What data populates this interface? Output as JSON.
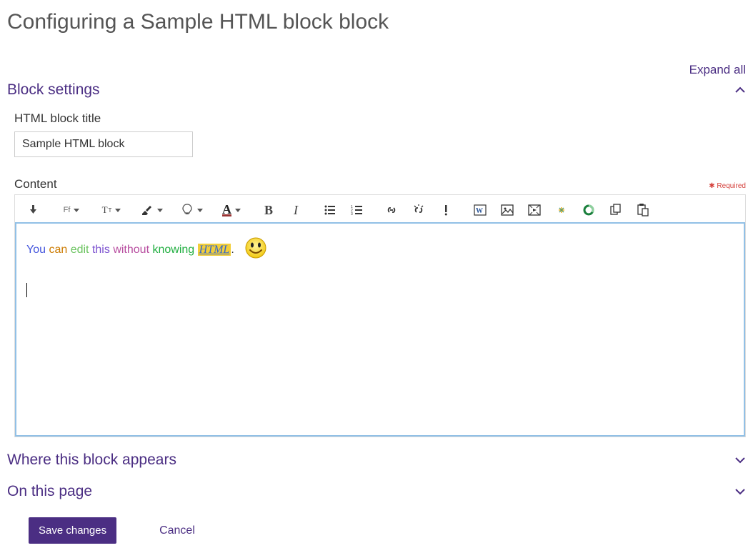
{
  "page": {
    "title": "Configuring a Sample HTML block block"
  },
  "links": {
    "expand_all": "Expand all"
  },
  "sections": {
    "block_settings": "Block settings",
    "where_appears": "Where this block appears",
    "on_this_page": "On this page"
  },
  "fields": {
    "html_block_title_label": "HTML block title",
    "html_block_title_value": "Sample HTML block",
    "content_label": "Content",
    "required_note": "✱ Required"
  },
  "editor_content": {
    "you": "You",
    "can": "can",
    "edit": "edit",
    "this": "this",
    "without": "without",
    "knowing": "knowing",
    "html": "HTML",
    "dot": "."
  },
  "toolbar": {
    "font_family_label": "Ff",
    "text_size_label": "T",
    "text_size_sub": "T",
    "font_color_label": "A",
    "bold_label": "B",
    "italic_label": "I"
  },
  "actions": {
    "save": "Save changes",
    "cancel": "Cancel"
  }
}
